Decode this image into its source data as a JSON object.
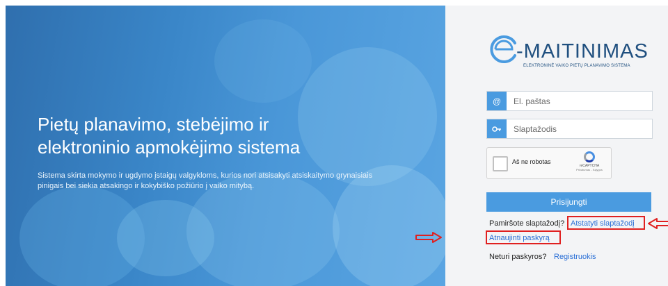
{
  "hero": {
    "headline_line1": "Pietų planavimo, stebėjimo ir",
    "headline_line2": "elektroninio apmokėjimo sistema",
    "description": "Sistema skirta mokymo ir ugdymo įstaigų valgykloms, kurios nori atsisakyti atsiskaitymo grynaisiais pinigais bei siekia atsakingo ir kokybiško požiūrio į vaiko mitybą."
  },
  "logo": {
    "wordmark": "-MAITINIMAS",
    "tagline": "ELEKTRONINĖ VAIKO PIETŲ PLANAVIMO SISTEMA"
  },
  "login": {
    "email_placeholder": "El. paštas",
    "email_icon": "@",
    "password_placeholder": "Slaptažodis",
    "password_icon": "key-icon",
    "captcha_label": "Aš ne robotas",
    "captcha_brand": "reCAPTCHA",
    "captcha_terms": "Privatumas - Sąlygos",
    "submit_label": "Prisijungti",
    "forgot_text": "Pamiršote slaptažodį?",
    "reset_link": "Atstatyti slaptažodį",
    "renew_link": "Atnaujinti paskyrą",
    "no_account_text": "Neturi paskyros?",
    "register_link": "Registruokis"
  },
  "colors": {
    "accent": "#4a9be0",
    "link": "#2a6fd6",
    "highlight": "#e02020"
  }
}
